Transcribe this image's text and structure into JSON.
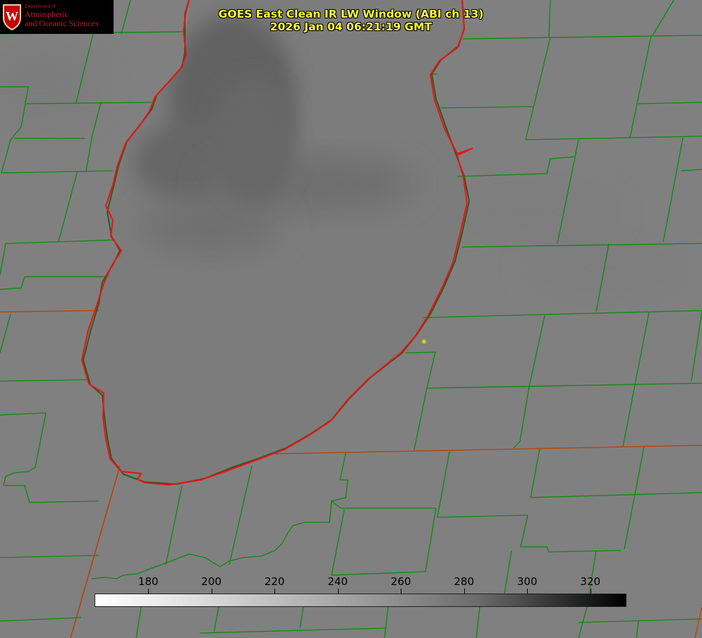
{
  "title": {
    "line1": "GOES East Clean IR LW Window (ABI ch 13)",
    "line2": "2026 Jan 04 06:21:19 GMT"
  },
  "logo": {
    "department": "Department of",
    "line1": "Atmospheric",
    "line2": "and Oceanic Sciences",
    "shield_letter": "W"
  },
  "colorbar": {
    "range": [
      163,
      331
    ],
    "tick_labels": [
      "180",
      "200",
      "220",
      "240",
      "260",
      "280",
      "300",
      "320"
    ],
    "tick_values": [
      180,
      200,
      220,
      240,
      260,
      280,
      300,
      320
    ],
    "colormap": "white-to-black grayscale"
  },
  "colors": {
    "lake_outline": "#ee1111",
    "county_lines": "#0b8a0b",
    "state_lines": "#b4460a",
    "title_text": "#ffff33",
    "background": "#808080",
    "lake_dark": "#6e6e6e"
  },
  "marker": {
    "color": "#e6c21a"
  }
}
